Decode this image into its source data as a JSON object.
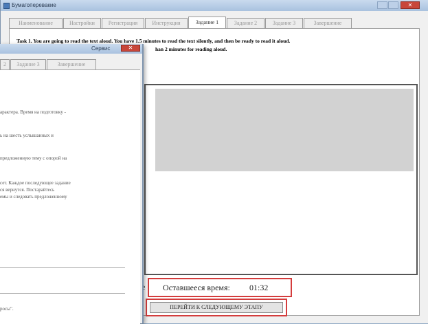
{
  "main_window": {
    "title": "Бумагоперевакие",
    "tabs": [
      {
        "label": "Наименование",
        "active": false
      },
      {
        "label": "Настройки",
        "active": false
      },
      {
        "label": "Регистрация",
        "active": false
      },
      {
        "label": "Инструкция",
        "active": false
      },
      {
        "label": "Задание 1",
        "active": true
      },
      {
        "label": "Задание 2",
        "active": false
      },
      {
        "label": "Задание 3",
        "active": false
      },
      {
        "label": "Завершение",
        "active": false
      }
    ],
    "task_text_line1": "Task 1. You are going to read the text aloud. You have 1.5 minutes to read the text silently, and then be ready to read it aloud.",
    "task_text_line2": "han 2 minutes for reading aloud.",
    "timer": {
      "label": "Оставшееся время:",
      "value": "01:32",
      "left_fragment": "е"
    },
    "next_button_label": "ПЕРЕЙТИ К СЛЕДУЮЩЕМУ ЭТАПУ"
  },
  "back_window": {
    "title": "Сервис",
    "tabs": [
      {
        "label": "2"
      },
      {
        "label": "Задание 3"
      },
      {
        "label": "Завершение"
      }
    ],
    "lines": [
      "арактера. Время на подготовку -",
      "ь на шесть услышанных и",
      "предложенную тему с опорой на",
      "сет. Каждое последующее задание",
      "ся вернутся. Постарайтесь",
      "емы и следовать предложенному",
      "росы\"."
    ]
  }
}
